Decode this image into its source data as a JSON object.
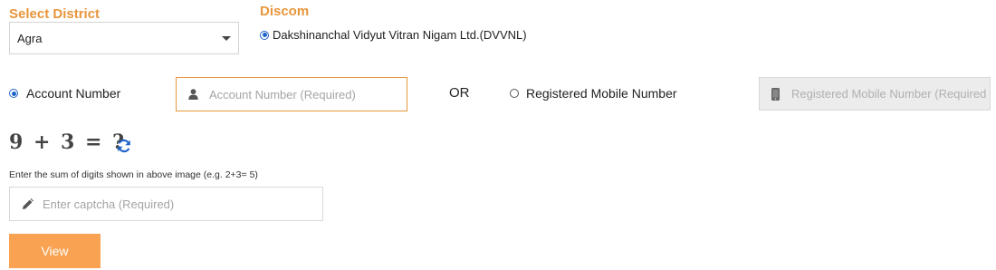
{
  "district": {
    "label": "Select District",
    "selected": "Agra"
  },
  "discom": {
    "label": "Discom",
    "option": "Dakshinanchal Vidyut Vitran Nigam Ltd.(DVVNL)"
  },
  "lookup": {
    "account_option": "Account Number",
    "account_placeholder": "Account Number (Required)",
    "or_text": "OR",
    "mobile_option": "Registered Mobile Number",
    "mobile_placeholder": "Registered Mobile Number (Required)"
  },
  "captcha": {
    "image_text": "9 + 3 = ?",
    "hint": "Enter the sum of digits shown in above image (e.g. 2+3= 5)",
    "placeholder": "Enter captcha (Required)"
  },
  "actions": {
    "view_label": "View"
  },
  "colors": {
    "accent": "#e8963c",
    "button": "#f9a251",
    "radio": "#1e63c8"
  },
  "icons": {
    "district_dropdown": "chevron-down-icon",
    "account": "user-icon",
    "mobile": "mobile-icon",
    "refresh": "refresh-icon",
    "captcha": "pencil-icon"
  }
}
